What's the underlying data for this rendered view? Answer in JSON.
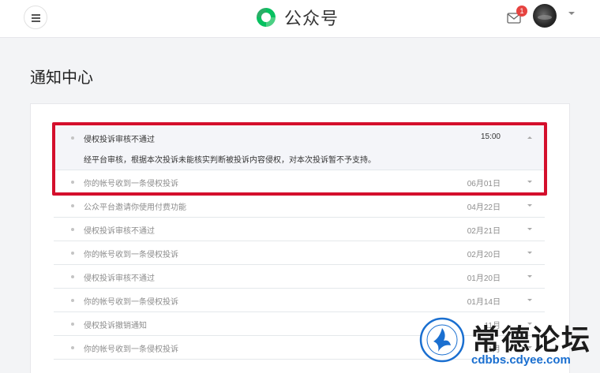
{
  "header": {
    "brand_name": "公众号",
    "mail_badge": "1",
    "brand_color": "#07c160"
  },
  "page": {
    "title": "通知中心"
  },
  "notifications": [
    {
      "title": "侵权投诉审核不通过",
      "date": "15:00",
      "expanded": true,
      "body": "经平台审核，根据本次投诉未能核实判断被投诉内容侵权，对本次投诉暂不予支持。"
    },
    {
      "title": "你的帐号收到一条侵权投诉",
      "date": "06月01日"
    },
    {
      "title": "公众平台邀请你使用付费功能",
      "date": "04月22日"
    },
    {
      "title": "侵权投诉审核不通过",
      "date": "02月21日"
    },
    {
      "title": "你的帐号收到一条侵权投诉",
      "date": "02月20日"
    },
    {
      "title": "侵权投诉审核不通过",
      "date": "01月20日"
    },
    {
      "title": "你的帐号收到一条侵权投诉",
      "date": "01月14日"
    },
    {
      "title": "侵权投诉撤销通知",
      "date": "11月"
    },
    {
      "title": "你的帐号收到一条侵权投诉",
      "date": "11月"
    }
  ],
  "watermark": {
    "site_name": "常德论坛",
    "url": "cdbbs.cdyee.com",
    "highlight_color": "#d40f2c"
  }
}
